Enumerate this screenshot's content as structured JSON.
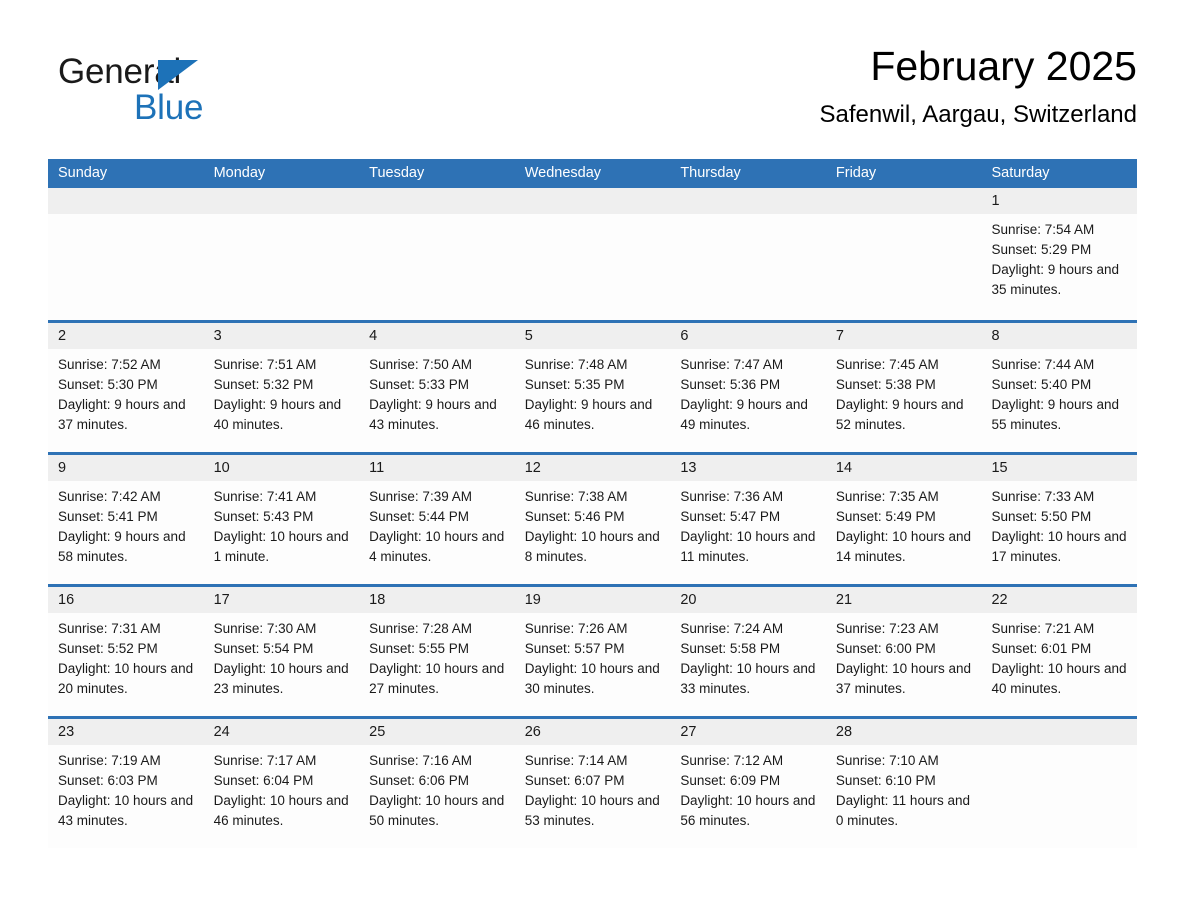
{
  "brand": {
    "name_part1": "General",
    "name_part2": "Blue",
    "triangle_icon": "triangle-right-icon",
    "accent_color": "#1d72b8"
  },
  "header": {
    "title": "February 2025",
    "subtitle": "Safenwil, Aargau, Switzerland"
  },
  "colors": {
    "header_blue": "#2e72b5",
    "day_band_gray": "#efefef",
    "cell_background": "#fdfdfd",
    "text": "#1a1a1a"
  },
  "weekdays": [
    "Sunday",
    "Monday",
    "Tuesday",
    "Wednesday",
    "Thursday",
    "Friday",
    "Saturday"
  ],
  "weeks": [
    [
      {
        "day": "",
        "sunrise": "",
        "sunset": "",
        "daylight": "",
        "empty": true
      },
      {
        "day": "",
        "sunrise": "",
        "sunset": "",
        "daylight": "",
        "empty": true
      },
      {
        "day": "",
        "sunrise": "",
        "sunset": "",
        "daylight": "",
        "empty": true
      },
      {
        "day": "",
        "sunrise": "",
        "sunset": "",
        "daylight": "",
        "empty": true
      },
      {
        "day": "",
        "sunrise": "",
        "sunset": "",
        "daylight": "",
        "empty": true
      },
      {
        "day": "",
        "sunrise": "",
        "sunset": "",
        "daylight": "",
        "empty": true
      },
      {
        "day": "1",
        "sunrise": "Sunrise: 7:54 AM",
        "sunset": "Sunset: 5:29 PM",
        "daylight": "Daylight: 9 hours and 35 minutes.",
        "empty": false
      }
    ],
    [
      {
        "day": "2",
        "sunrise": "Sunrise: 7:52 AM",
        "sunset": "Sunset: 5:30 PM",
        "daylight": "Daylight: 9 hours and 37 minutes.",
        "empty": false
      },
      {
        "day": "3",
        "sunrise": "Sunrise: 7:51 AM",
        "sunset": "Sunset: 5:32 PM",
        "daylight": "Daylight: 9 hours and 40 minutes.",
        "empty": false
      },
      {
        "day": "4",
        "sunrise": "Sunrise: 7:50 AM",
        "sunset": "Sunset: 5:33 PM",
        "daylight": "Daylight: 9 hours and 43 minutes.",
        "empty": false
      },
      {
        "day": "5",
        "sunrise": "Sunrise: 7:48 AM",
        "sunset": "Sunset: 5:35 PM",
        "daylight": "Daylight: 9 hours and 46 minutes.",
        "empty": false
      },
      {
        "day": "6",
        "sunrise": "Sunrise: 7:47 AM",
        "sunset": "Sunset: 5:36 PM",
        "daylight": "Daylight: 9 hours and 49 minutes.",
        "empty": false
      },
      {
        "day": "7",
        "sunrise": "Sunrise: 7:45 AM",
        "sunset": "Sunset: 5:38 PM",
        "daylight": "Daylight: 9 hours and 52 minutes.",
        "empty": false
      },
      {
        "day": "8",
        "sunrise": "Sunrise: 7:44 AM",
        "sunset": "Sunset: 5:40 PM",
        "daylight": "Daylight: 9 hours and 55 minutes.",
        "empty": false
      }
    ],
    [
      {
        "day": "9",
        "sunrise": "Sunrise: 7:42 AM",
        "sunset": "Sunset: 5:41 PM",
        "daylight": "Daylight: 9 hours and 58 minutes.",
        "empty": false
      },
      {
        "day": "10",
        "sunrise": "Sunrise: 7:41 AM",
        "sunset": "Sunset: 5:43 PM",
        "daylight": "Daylight: 10 hours and 1 minute.",
        "empty": false
      },
      {
        "day": "11",
        "sunrise": "Sunrise: 7:39 AM",
        "sunset": "Sunset: 5:44 PM",
        "daylight": "Daylight: 10 hours and 4 minutes.",
        "empty": false
      },
      {
        "day": "12",
        "sunrise": "Sunrise: 7:38 AM",
        "sunset": "Sunset: 5:46 PM",
        "daylight": "Daylight: 10 hours and 8 minutes.",
        "empty": false
      },
      {
        "day": "13",
        "sunrise": "Sunrise: 7:36 AM",
        "sunset": "Sunset: 5:47 PM",
        "daylight": "Daylight: 10 hours and 11 minutes.",
        "empty": false
      },
      {
        "day": "14",
        "sunrise": "Sunrise: 7:35 AM",
        "sunset": "Sunset: 5:49 PM",
        "daylight": "Daylight: 10 hours and 14 minutes.",
        "empty": false
      },
      {
        "day": "15",
        "sunrise": "Sunrise: 7:33 AM",
        "sunset": "Sunset: 5:50 PM",
        "daylight": "Daylight: 10 hours and 17 minutes.",
        "empty": false
      }
    ],
    [
      {
        "day": "16",
        "sunrise": "Sunrise: 7:31 AM",
        "sunset": "Sunset: 5:52 PM",
        "daylight": "Daylight: 10 hours and 20 minutes.",
        "empty": false
      },
      {
        "day": "17",
        "sunrise": "Sunrise: 7:30 AM",
        "sunset": "Sunset: 5:54 PM",
        "daylight": "Daylight: 10 hours and 23 minutes.",
        "empty": false
      },
      {
        "day": "18",
        "sunrise": "Sunrise: 7:28 AM",
        "sunset": "Sunset: 5:55 PM",
        "daylight": "Daylight: 10 hours and 27 minutes.",
        "empty": false
      },
      {
        "day": "19",
        "sunrise": "Sunrise: 7:26 AM",
        "sunset": "Sunset: 5:57 PM",
        "daylight": "Daylight: 10 hours and 30 minutes.",
        "empty": false
      },
      {
        "day": "20",
        "sunrise": "Sunrise: 7:24 AM",
        "sunset": "Sunset: 5:58 PM",
        "daylight": "Daylight: 10 hours and 33 minutes.",
        "empty": false
      },
      {
        "day": "21",
        "sunrise": "Sunrise: 7:23 AM",
        "sunset": "Sunset: 6:00 PM",
        "daylight": "Daylight: 10 hours and 37 minutes.",
        "empty": false
      },
      {
        "day": "22",
        "sunrise": "Sunrise: 7:21 AM",
        "sunset": "Sunset: 6:01 PM",
        "daylight": "Daylight: 10 hours and 40 minutes.",
        "empty": false
      }
    ],
    [
      {
        "day": "23",
        "sunrise": "Sunrise: 7:19 AM",
        "sunset": "Sunset: 6:03 PM",
        "daylight": "Daylight: 10 hours and 43 minutes.",
        "empty": false
      },
      {
        "day": "24",
        "sunrise": "Sunrise: 7:17 AM",
        "sunset": "Sunset: 6:04 PM",
        "daylight": "Daylight: 10 hours and 46 minutes.",
        "empty": false
      },
      {
        "day": "25",
        "sunrise": "Sunrise: 7:16 AM",
        "sunset": "Sunset: 6:06 PM",
        "daylight": "Daylight: 10 hours and 50 minutes.",
        "empty": false
      },
      {
        "day": "26",
        "sunrise": "Sunrise: 7:14 AM",
        "sunset": "Sunset: 6:07 PM",
        "daylight": "Daylight: 10 hours and 53 minutes.",
        "empty": false
      },
      {
        "day": "27",
        "sunrise": "Sunrise: 7:12 AM",
        "sunset": "Sunset: 6:09 PM",
        "daylight": "Daylight: 10 hours and 56 minutes.",
        "empty": false
      },
      {
        "day": "28",
        "sunrise": "Sunrise: 7:10 AM",
        "sunset": "Sunset: 6:10 PM",
        "daylight": "Daylight: 11 hours and 0 minutes.",
        "empty": false
      },
      {
        "day": "",
        "sunrise": "",
        "sunset": "",
        "daylight": "",
        "empty": true
      }
    ]
  ]
}
